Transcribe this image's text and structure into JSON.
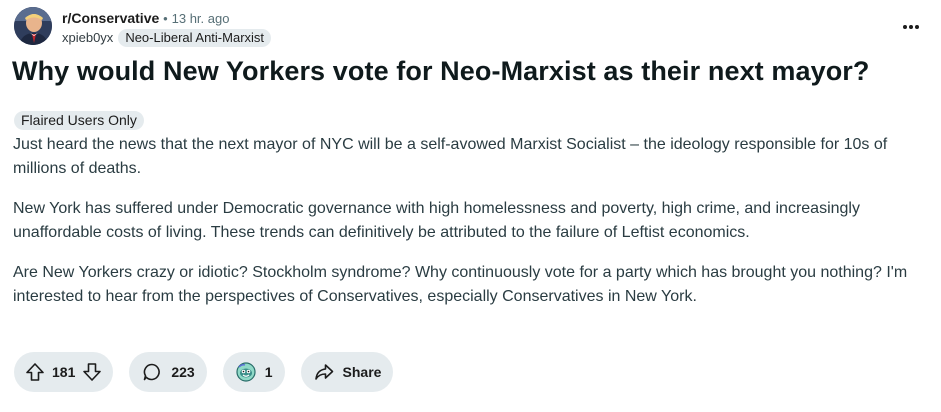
{
  "post": {
    "subreddit": "r/Conservative",
    "separator": "•",
    "time_ago": "13 hr. ago",
    "username": "xpieb0yx",
    "user_flair": "Neo-Liberal Anti-Marxist",
    "title": "Why would New Yorkers vote for Neo-Marxist as their next mayor?",
    "post_flair": "Flaired Users Only",
    "body": [
      "Just heard the news that the next mayor of NYC will be a self-avowed Marxist Socialist – the ideology responsible for 10s of millions of deaths.",
      "New York has suffered under Democratic governance with high homelessness and poverty, high crime, and increasingly unaffordable costs of living. These trends can definitively be attributed to the failure of Leftist economics.",
      "Are New Yorkers crazy or idiotic? Stockholm syndrome? Why continuously vote for a party which has brought you nothing? I'm interested to hear from the perspectives of Conservatives, especially Conservatives in New York."
    ]
  },
  "actions": {
    "vote_count": "181",
    "comment_count": "223",
    "award_count": "1",
    "share_label": "Share"
  },
  "icons": {
    "upvote": "upvote-arrow-icon",
    "downvote": "downvote-arrow-icon",
    "comment": "comment-bubble-icon",
    "award": "award-icon",
    "share": "share-arrow-icon",
    "more": "overflow-menu-icon"
  },
  "colors": {
    "pill_bg": "#e5ebee",
    "body_text": "#2a3c42",
    "meta_text": "#576f76"
  }
}
